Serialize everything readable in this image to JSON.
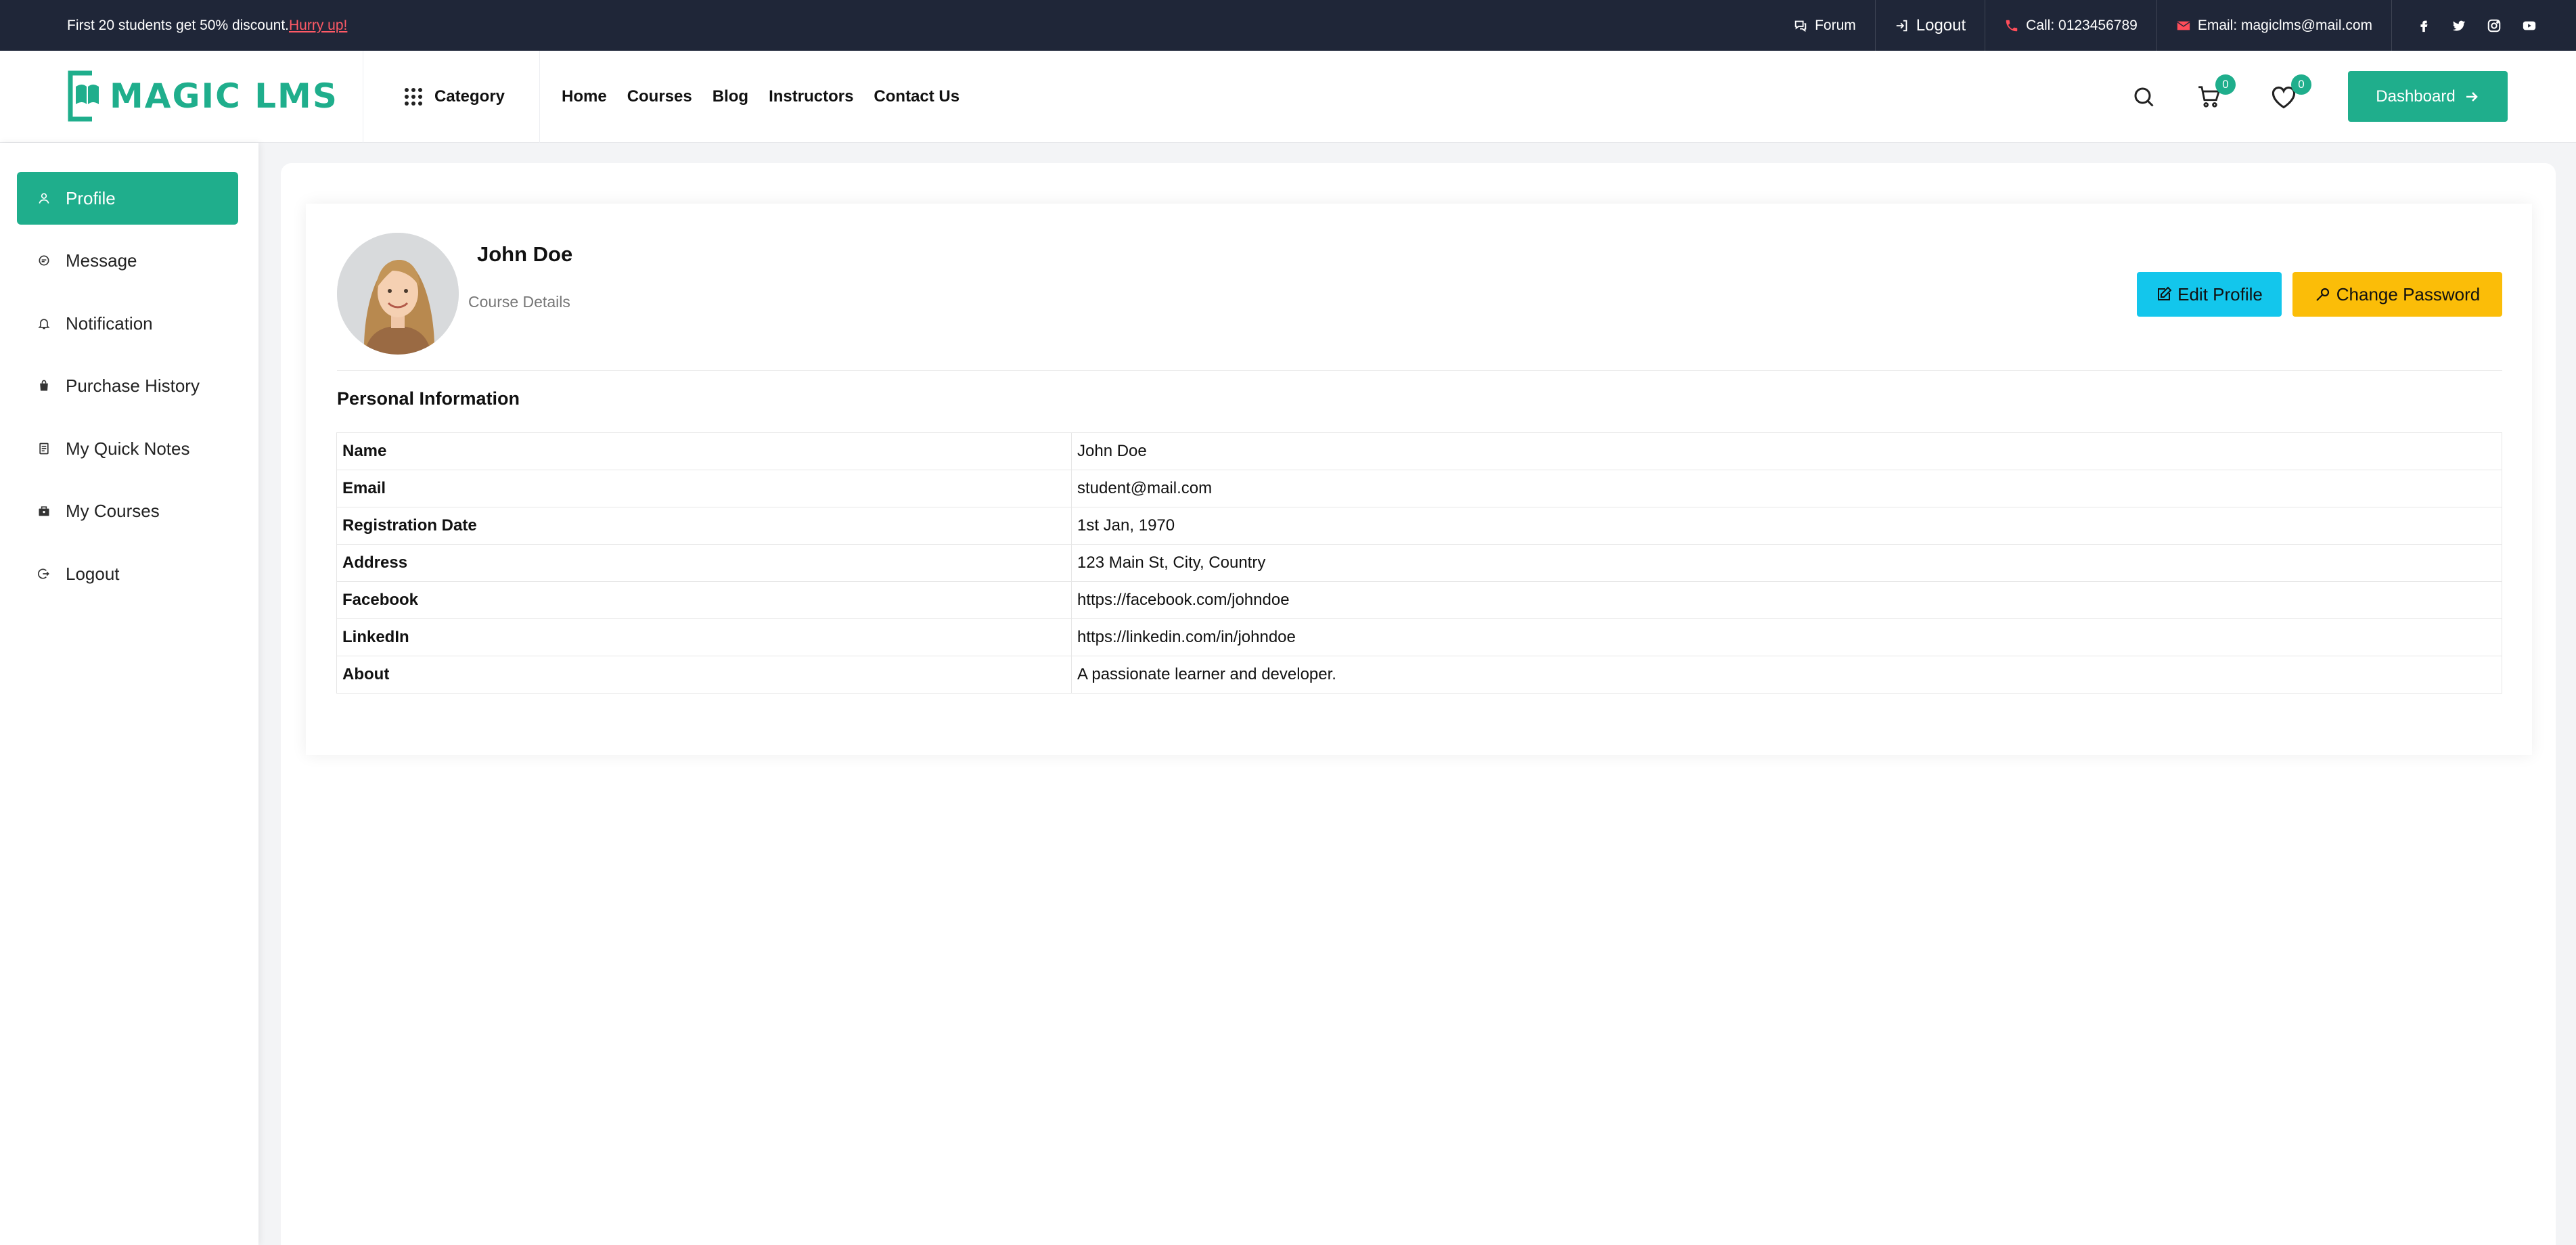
{
  "topbar": {
    "promo_text": "First 20 students get 50% discount.",
    "promo_link": "Hurry up!",
    "forum": "Forum",
    "logout": "Logout",
    "call": "Call: 0123456789",
    "email": "Email: magiclms@mail.com",
    "social_icons": [
      "facebook-icon",
      "twitter-icon",
      "instagram-icon",
      "youtube-icon"
    ]
  },
  "header": {
    "logo_text": "MAGIC LMS",
    "category": "Category",
    "nav": [
      "Home",
      "Courses",
      "Blog",
      "Instructors",
      "Contact Us"
    ],
    "cart_count": "0",
    "wishlist_count": "0",
    "dashboard": "Dashboard"
  },
  "sidebar": {
    "items": [
      {
        "label": "Profile",
        "icon": "user-icon",
        "active": true
      },
      {
        "label": "Message",
        "icon": "chat-icon"
      },
      {
        "label": "Notification",
        "icon": "bell-icon"
      },
      {
        "label": "Purchase History",
        "icon": "bag-icon"
      },
      {
        "label": "My Quick Notes",
        "icon": "notes-icon"
      },
      {
        "label": "My Courses",
        "icon": "courses-icon"
      },
      {
        "label": "Logout",
        "icon": "logout-icon"
      }
    ]
  },
  "profile": {
    "name": "John Doe",
    "subtitle": "Course Details",
    "edit_button": "Edit Profile",
    "password_button": "Change Password",
    "section_title": "Personal Information",
    "rows": [
      {
        "key": "Name",
        "value": "John Doe"
      },
      {
        "key": "Email",
        "value": "student@mail.com"
      },
      {
        "key": "Registration Date",
        "value": "1st Jan, 1970"
      },
      {
        "key": "Address",
        "value": "123 Main St, City, Country"
      },
      {
        "key": "Facebook",
        "value": "https://facebook.com/johndoe"
      },
      {
        "key": "LinkedIn",
        "value": "https://linkedin.com/in/johndoe"
      },
      {
        "key": "About",
        "value": "A passionate learner and developer."
      }
    ]
  },
  "colors": {
    "brand": "#1fae8c",
    "topbar": "#1f2638",
    "edit_button": "#13c6ec",
    "password_button": "#fbbd08",
    "promo_link": "#ff5a66",
    "contact_icons": "#ff4d5a"
  }
}
